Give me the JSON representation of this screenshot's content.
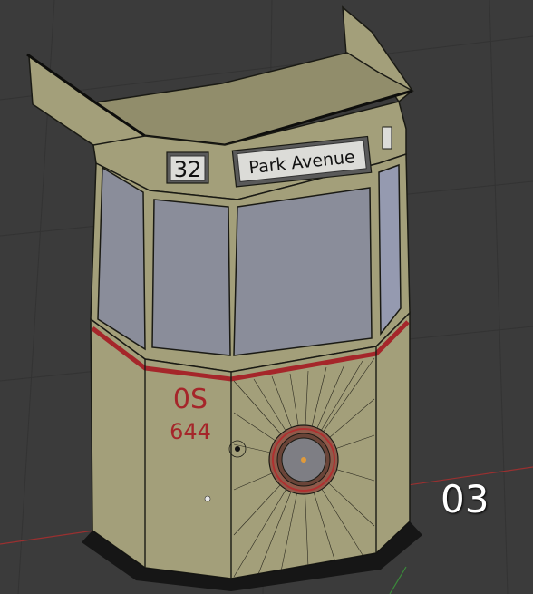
{
  "scene": {
    "route_number": "32",
    "destination": "Park Avenue",
    "fleet_code": "0S",
    "fleet_number": "644",
    "frame_label": "03",
    "colors": {
      "background": "#3b3b3b",
      "body": "#a39f7a",
      "body_dark": "#6f6c52",
      "glass": "#8a8d9a",
      "stripe": "#a5262a",
      "wire": "#1a1a14",
      "axis_x": "#9a3030",
      "axis_y": "#3a8a3a"
    },
    "icons": [
      "headlight-icon",
      "marker-light-icon",
      "axis-x-line",
      "axis-y-line"
    ]
  }
}
